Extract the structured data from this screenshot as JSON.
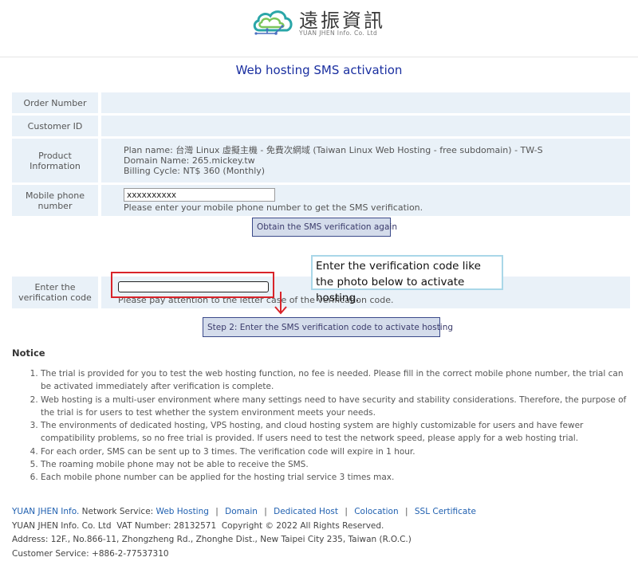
{
  "brand": {
    "logo_name": "遠振資訊",
    "logo_sub": "YUAN JHEN Info. Co. Ltd"
  },
  "page_title": "Web hosting SMS activation",
  "form": {
    "order_number_label": "Order Number",
    "order_number_value": "",
    "customer_id_label": "Customer ID",
    "customer_id_value": "",
    "product_label": "Product Information",
    "plan_name": "Plan name: 台灣 Linux 虛擬主機 - 免費次網域 (Taiwan Linux Web Hosting - free subdomain) - TW-S",
    "domain_name": "Domain Name: 265.mickey.tw",
    "billing_cycle": "Billing Cycle: NT$ 360 (Monthly)",
    "mobile_label": "Mobile phone number",
    "mobile_value": "xxxxxxxxxx",
    "mobile_hint": "Please enter your mobile phone number to get the SMS verification.",
    "resend_button": "Obtain the SMS verification again",
    "verify_label": "Enter the verification code",
    "verify_value": "",
    "verify_hint": "Please pay attention to the letter case of the verification code.",
    "step2_button": "Step 2: Enter the SMS verification code to activate hosting"
  },
  "annotation": {
    "callout_text": "Enter the verification code like the photo below to activate hosting.",
    "highlight_color": "#d9242a",
    "callout_border_color": "#a9d7e8"
  },
  "notice": {
    "title": "Notice",
    "items": [
      "The trial is provided for you to test the web hosting function, no fee is needed. Please fill in the correct mobile phone number, the trial can be activated immediately after verification is complete.",
      "Web hosting is a multi-user environment where many settings need to have security and stability considerations. Therefore, the purpose of the trial is for users to test whether the system environment meets your needs.",
      "The environments of dedicated hosting, VPS hosting, and cloud hosting system are highly customizable for users and have fewer compatibility problems, so no free trial is provided. If users need to test the network speed, please apply for a web hosting trial.",
      "For each order, SMS can be sent up to 3 times. The verification code will expire in 1 hour.",
      "The roaming mobile phone may not be able to receive the SMS.",
      "Each mobile phone number can be applied for the hosting trial service 3 times max."
    ]
  },
  "footer": {
    "brand_link": "YUAN JHEN Info.",
    "network_service_label": "Network Service:",
    "separator": "|",
    "links": [
      "Web Hosting",
      "Domain",
      "Dedicated Host",
      "Colocation",
      "SSL Certificate"
    ],
    "company_line": "YUAN JHEN Info. Co. Ltd  VAT Number: 28132571  Copyright © 2022 All Rights Reserved.",
    "address_line": "Address: 12F., No.866-11, Zhongzheng Rd., Zhonghe Dist., New Taipei City 235, Taiwan (R.O.C.)",
    "service_line": "Customer Service: +886-2-77537310"
  },
  "colors": {
    "title_blue": "#1a2fa0",
    "row_bg": "#e9f1f8",
    "link_blue": "#2060b0",
    "button_bg": "#d4dceb",
    "button_border": "#3b4a8a"
  }
}
